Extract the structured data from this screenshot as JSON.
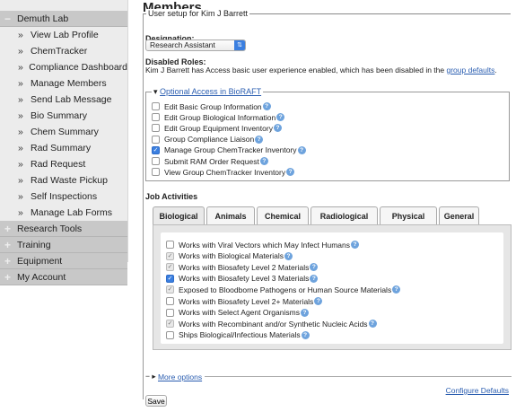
{
  "sidebar": {
    "sections": [
      {
        "label": "Demuth Lab",
        "symbol": "−"
      },
      {
        "label": "Research Tools",
        "symbol": "+"
      },
      {
        "label": "Training",
        "symbol": "+"
      },
      {
        "label": "Equipment",
        "symbol": "+"
      },
      {
        "label": "My Account",
        "symbol": "+"
      }
    ],
    "items": [
      "View Lab Profile",
      "ChemTracker",
      "Compliance Dashboard",
      "Manage Members",
      "Send Lab Message",
      "Bio Summary",
      "Chem Summary",
      "Rad Summary",
      "Rad Request",
      "Rad Waste Pickup",
      "Self Inspections",
      "Manage Lab Forms"
    ],
    "item_bullet": "»"
  },
  "main": {
    "title": "Members",
    "setup_legend": "User setup for Kim J Barrett",
    "designation_label": "Designation:",
    "designation_value": "Research Assistant",
    "disabled_roles_label": "Disabled Roles:",
    "disabled_roles_text": "Kim J Barrett has Access basic user experience enabled, which has been disabled in the",
    "group_defaults_link": "group defaults",
    "disabled_roles_end": ".",
    "optional_access_legend": "Optional Access in BioRAFT",
    "optional_access_toggle": "▾",
    "optional_access": [
      {
        "label": "Edit Basic Group Information",
        "checked": false
      },
      {
        "label": "Edit Group Biological Information",
        "checked": false
      },
      {
        "label": "Edit Group Equipment Inventory",
        "checked": false
      },
      {
        "label": "Group Compliance Liaison",
        "checked": false
      },
      {
        "label": "Manage Group ChemTracker Inventory",
        "checked": true
      },
      {
        "label": "Submit RAM Order Request",
        "checked": false
      },
      {
        "label": "View Group ChemTracker Inventory",
        "checked": false
      }
    ],
    "job_activities_label": "Job Activities",
    "tabs": [
      "Biological",
      "Animals",
      "Chemical",
      "Radiological",
      "Physical",
      "General"
    ],
    "active_tab": "Biological",
    "activities": [
      {
        "label": "Works with Viral Vectors which May Infect Humans",
        "state": "unchecked"
      },
      {
        "label": "Works with Biological Materials",
        "state": "grey"
      },
      {
        "label": "Works with Biosafety Level 2 Materials",
        "state": "grey"
      },
      {
        "label": "Works with Biosafety Level 3 Materials",
        "state": "checked"
      },
      {
        "label": "Exposed to Bloodborne Pathogens or Human Source Materials",
        "state": "grey"
      },
      {
        "label": "Works with Biosafety Level 2+ Materials",
        "state": "unchecked"
      },
      {
        "label": "Works with Select Agent Organisms",
        "state": "unchecked"
      },
      {
        "label": "Works with Recombinant and/or Synthetic Nucleic Acids",
        "state": "grey"
      },
      {
        "label": "Ships Biological/Infectious Materials",
        "state": "unchecked"
      }
    ],
    "more_options": "More options",
    "more_options_toggle": "− ▸",
    "configure_defaults": "Configure Defaults",
    "save_label": "Save",
    "help_glyph": "?",
    "check_glyph": "✓"
  },
  "colors": {
    "accent": "#3b7fe0",
    "link": "#2a5db0",
    "sidebar_section": "#c8c8c8",
    "sidebar_bg": "#ececec"
  }
}
